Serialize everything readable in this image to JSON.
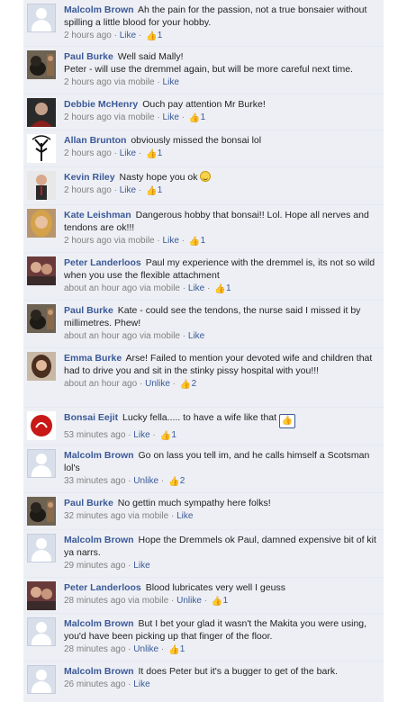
{
  "separator": "·",
  "comments": [
    {
      "author": "Malcolm Brown",
      "text": "Ah the pain for the passion, not a true bonsaier without spilling a little blood for your hobby.",
      "time": "2 hours ago",
      "action": "Like",
      "likes": "1",
      "avatar": "default-avatar"
    },
    {
      "author": "Paul Burke",
      "text": "Well said Mally!",
      "text2": "Peter - will use the dremmel again, but will be more careful next time.",
      "time": "2 hours ago via mobile",
      "action": "Like",
      "avatar": "dog-photo"
    },
    {
      "author": "Debbie McHenry",
      "text": "Ouch pay attention Mr Burke!",
      "time": "2 hours ago via mobile",
      "action": "Like",
      "likes": "1",
      "avatar": "person-photo"
    },
    {
      "author": "Allan Brunton",
      "text": "obviously missed the bonsai lol",
      "time": "2 hours ago",
      "action": "Like",
      "likes": "1",
      "avatar": "tree-drawing"
    },
    {
      "author": "Kevin Riley",
      "text": "Nasty hope you ok",
      "time": "2 hours ago",
      "action": "Like",
      "likes": "1",
      "avatar": "person-photo"
    },
    {
      "author": "Kate Leishman",
      "text": "Dangerous hobby that bonsai!! Lol. Hope all nerves and tendons are ok!!!",
      "time": "2 hours ago via mobile",
      "action": "Like",
      "likes": "1",
      "avatar": "person-photo"
    },
    {
      "author": "Peter Landerloos",
      "text": "Paul my experience with the dremmel is, its not so wild when you use the flexible attachment",
      "time": "about an hour ago via mobile",
      "action": "Like",
      "likes": "1",
      "avatar": "couple-photo"
    },
    {
      "author": "Paul Burke",
      "text": "Kate - could see the tendons, the nurse said I missed it by millimetres. Phew!",
      "time": "about an hour ago via mobile",
      "action": "Like",
      "avatar": "dog-photo"
    },
    {
      "author": "Emma Burke",
      "text": "Arse! Failed to mention your devoted wife and children that had to drive you and sit in the stinky pissy hospital with you!!!",
      "time": "about an hour ago",
      "action": "Unlike",
      "likes": "2",
      "avatar": "person-photo"
    },
    {
      "author": "Bonsai Eejit",
      "text": "Lucky fella..... to have a wife like that",
      "time": "53 minutes ago",
      "action": "Like",
      "likes": "1",
      "avatar": "red-logo"
    },
    {
      "author": "Malcolm Brown",
      "text": "Go on lass you tell im, and he calls himself a Scotsman lol's",
      "time": "33 minutes ago",
      "action": "Unlike",
      "likes": "2",
      "avatar": "default-avatar"
    },
    {
      "author": "Paul Burke",
      "text": "No gettin much sympathy here folks!",
      "time": "32 minutes ago via mobile",
      "action": "Like",
      "avatar": "dog-photo"
    },
    {
      "author": "Malcolm Brown",
      "text": "Hope the Dremmels ok Paul, damned expensive bit of kit ya narrs.",
      "time": "29 minutes ago",
      "action": "Like",
      "avatar": "default-avatar"
    },
    {
      "author": "Peter Landerloos",
      "text": "Blood lubricates very well I geuss",
      "time": "28 minutes ago via mobile",
      "action": "Unlike",
      "likes": "1",
      "avatar": "couple-photo"
    },
    {
      "author": "Malcolm Brown",
      "text": "But I bet your glad it wasn't the Makita you were using, you'd have been picking up that finger of the floor.",
      "time": "28 minutes ago",
      "action": "Unlike",
      "likes": "1",
      "avatar": "default-avatar"
    },
    {
      "author": "Malcolm Brown",
      "text": "It does Peter but it's a bugger to get of the bark.",
      "time": "26 minutes ago",
      "action": "Like",
      "avatar": "default-avatar"
    }
  ]
}
